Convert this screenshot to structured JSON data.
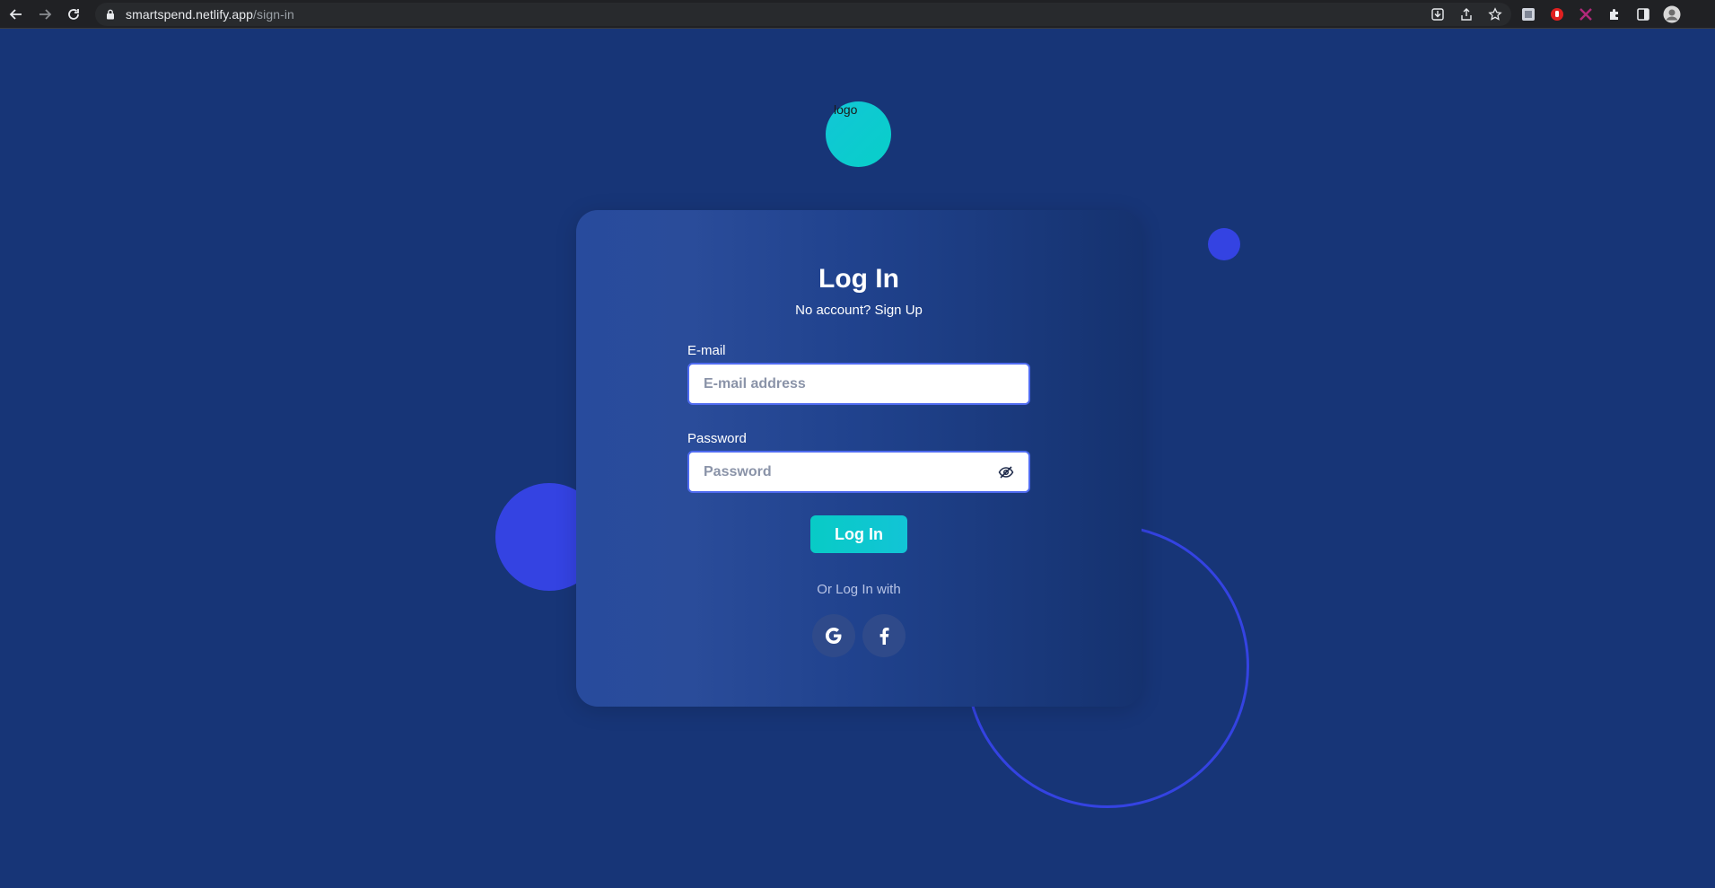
{
  "browser": {
    "url_host": "smartspend.netlify.app",
    "url_path": "/sign-in"
  },
  "logo": {
    "alt": "logo"
  },
  "login": {
    "title": "Log In",
    "no_account": "No account? ",
    "signup_link": "Sign Up",
    "email_label": "E-mail",
    "email_placeholder": "E-mail address",
    "email_value": "",
    "password_label": "Password",
    "password_placeholder": "Password",
    "password_value": "",
    "submit_label": "Log In",
    "or_text": "Or Log In with"
  },
  "colors": {
    "background": "#173577",
    "accent_teal": "#08cbc6",
    "accent_blue": "#3443e2"
  },
  "icons": {
    "password_toggle": "eye-off-icon",
    "social_google": "google-icon",
    "social_facebook": "facebook-icon"
  }
}
